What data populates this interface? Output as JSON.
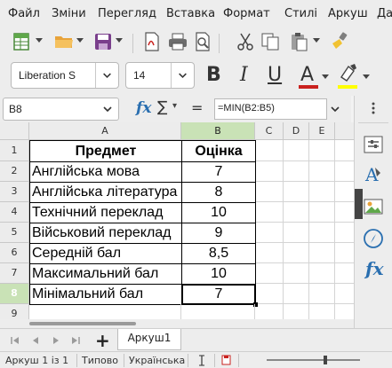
{
  "menubar": {
    "items": [
      "Файл",
      "Зміни",
      "Перегляд",
      "Вставка",
      "Формат",
      "Стилі",
      "Аркуш",
      "Да"
    ]
  },
  "toolbar": {
    "font_name": "Liberation S",
    "font_size": "14",
    "bold_label": "B",
    "italic_label": "I",
    "underline_label": "U",
    "font_color_label": "A",
    "font_color": "#c9211e",
    "highlight_color": "#ffff00"
  },
  "formula_bar": {
    "name_box": "B8",
    "fx_label": "fx",
    "sum_label": "∑",
    "sum_arrow": "▾",
    "equals_label": "=",
    "formula": "=MIN(B2:B5)"
  },
  "grid": {
    "columns": [
      "A",
      "B",
      "C",
      "D",
      "E"
    ],
    "rows": [
      "1",
      "2",
      "3",
      "4",
      "5",
      "6",
      "7",
      "8",
      "9"
    ],
    "cells": {
      "header": [
        "Предмет",
        "Оцінка"
      ],
      "data": [
        [
          "Англійська мова",
          "7"
        ],
        [
          "Англійська література",
          "8"
        ],
        [
          "Технічний переклад",
          "10"
        ],
        [
          "Військовий переклад",
          "9"
        ],
        [
          "Середній бал",
          "8,5"
        ],
        [
          "Максимальний бал",
          "10"
        ],
        [
          "Мінімальний бал",
          "7"
        ]
      ]
    },
    "selected_cell": "B8",
    "accent": "#c9e2b6"
  },
  "sheet_tabs": {
    "add_label": "+",
    "tabs": [
      "Аркуш1"
    ]
  },
  "status": {
    "sheet_info": "Аркуш 1 із 1",
    "style": "Типово",
    "language": "Українська"
  }
}
